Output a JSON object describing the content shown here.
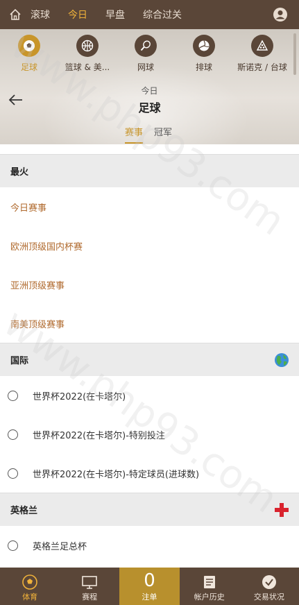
{
  "topnav": {
    "tabs": [
      "滚球",
      "今日",
      "早盘",
      "综合过关"
    ],
    "active_tab": "今日"
  },
  "sports": [
    {
      "label": "足球",
      "icon": "soccer-ball-icon"
    },
    {
      "label": "篮球 & 美...",
      "icon": "basketball-icon"
    },
    {
      "label": "网球",
      "icon": "tennis-icon"
    },
    {
      "label": "排球",
      "icon": "volleyball-icon"
    },
    {
      "label": "斯诺克 / 台球",
      "icon": "snooker-icon"
    }
  ],
  "header": {
    "subtitle": "今日",
    "title": "足球",
    "tabs": [
      "赛事",
      "冠军"
    ]
  },
  "sections": {
    "hot": {
      "title": "最火",
      "items": [
        "今日赛事",
        "欧洲顶级国内杯赛",
        "亚洲顶级赛事",
        "南美顶级赛事"
      ]
    },
    "international": {
      "title": "国际",
      "items": [
        "世界杯2022(在卡塔尔)",
        "世界杯2022(在卡塔尔)-特别投注",
        "世界杯2022(在卡塔尔)-特定球员(进球数)"
      ]
    },
    "england": {
      "title": "英格兰",
      "items": [
        "英格兰足总杯"
      ]
    }
  },
  "bottombar": {
    "sports": "体育",
    "schedule": "赛程",
    "bet_count": "0",
    "bet_label": "注单",
    "history": "帐户历史",
    "status": "交易状况"
  },
  "watermark": "www.php93.com",
  "colors": {
    "brand_brown": "#5a4638",
    "accent_gold": "#c8952a",
    "link_orange": "#b06a2e"
  }
}
